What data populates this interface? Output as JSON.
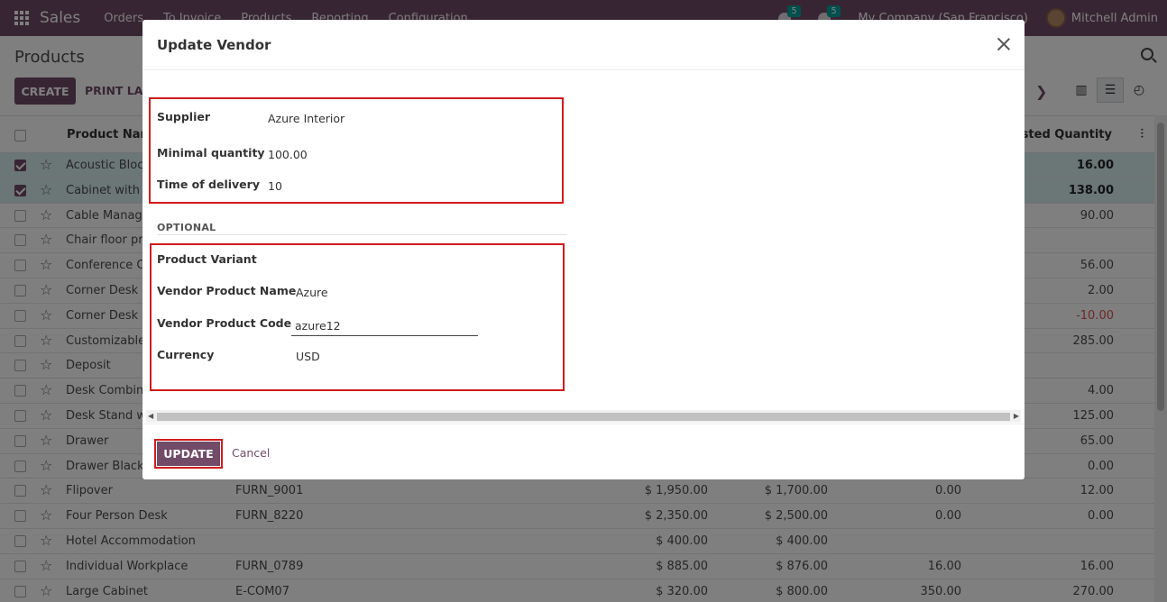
{
  "navbar": {
    "brand": "Sales",
    "menu": [
      "Orders",
      "To Invoice",
      "Products",
      "Reporting",
      "Configuration"
    ],
    "messages_count": "5",
    "activities_count": "5",
    "company": "My Company (San Francisco)",
    "user": "Mitchell Admin"
  },
  "control_panel": {
    "breadcrumb": "Products",
    "create_label": "CREATE",
    "print_label": "PRINT LABELS"
  },
  "list": {
    "columns": {
      "name": "Product Name",
      "forecast": "Forecasted Quantity"
    },
    "rows": [
      {
        "name": "Acoustic Bloc Screens",
        "ref": "",
        "price": "",
        "cost": "",
        "onhand": "",
        "forecast": "16.00",
        "selected": true
      },
      {
        "name": "Cabinet with Doors",
        "ref": "",
        "price": "",
        "cost": "",
        "onhand": "",
        "forecast": "138.00",
        "selected": true
      },
      {
        "name": "Cable Management Box",
        "ref": "",
        "price": "",
        "cost": "",
        "onhand": "",
        "forecast": "90.00",
        "selected": false
      },
      {
        "name": "Chair floor protection",
        "ref": "",
        "price": "",
        "cost": "",
        "onhand": "",
        "forecast": "",
        "selected": false
      },
      {
        "name": "Conference Chair",
        "ref": "",
        "price": "",
        "cost": "",
        "onhand": "",
        "forecast": "56.00",
        "selected": false
      },
      {
        "name": "Corner Desk Left Sit",
        "ref": "",
        "price": "",
        "cost": "",
        "onhand": "",
        "forecast": "2.00",
        "selected": false
      },
      {
        "name": "Corner Desk Right Sit",
        "ref": "",
        "price": "",
        "cost": "",
        "onhand": "",
        "forecast": "-10.00",
        "selected": false,
        "negative": true
      },
      {
        "name": "Customizable Desk",
        "ref": "",
        "price": "",
        "cost": "",
        "onhand": "",
        "forecast": "285.00",
        "selected": false
      },
      {
        "name": "Deposit",
        "ref": "",
        "price": "",
        "cost": "",
        "onhand": "",
        "forecast": "",
        "selected": false
      },
      {
        "name": "Desk Combination",
        "ref": "",
        "price": "",
        "cost": "",
        "onhand": "",
        "forecast": "4.00",
        "selected": false
      },
      {
        "name": "Desk Stand with Screen",
        "ref": "",
        "price": "",
        "cost": "",
        "onhand": "",
        "forecast": "125.00",
        "selected": false
      },
      {
        "name": "Drawer",
        "ref": "",
        "price": "",
        "cost": "",
        "onhand": "",
        "forecast": "65.00",
        "selected": false
      },
      {
        "name": "Drawer Black",
        "ref": "",
        "price": "",
        "cost": "",
        "onhand": "",
        "forecast": "0.00",
        "selected": false
      },
      {
        "name": "Flipover",
        "ref": "FURN_9001",
        "price": "$ 1,950.00",
        "cost": "$ 1,700.00",
        "onhand": "0.00",
        "forecast": "12.00",
        "selected": false
      },
      {
        "name": "Four Person Desk",
        "ref": "FURN_8220",
        "price": "$ 2,350.00",
        "cost": "$ 2,500.00",
        "onhand": "0.00",
        "forecast": "0.00",
        "selected": false
      },
      {
        "name": "Hotel Accommodation",
        "ref": "",
        "price": "$ 400.00",
        "cost": "$ 400.00",
        "onhand": "",
        "forecast": "",
        "selected": false
      },
      {
        "name": "Individual Workplace",
        "ref": "FURN_0789",
        "price": "$ 885.00",
        "cost": "$ 876.00",
        "onhand": "16.00",
        "forecast": "16.00",
        "selected": false
      },
      {
        "name": "Large Cabinet",
        "ref": "E-COM07",
        "price": "$ 320.00",
        "cost": "$ 800.00",
        "onhand": "350.00",
        "forecast": "270.00",
        "selected": false
      }
    ]
  },
  "modal": {
    "title": "Update Vendor",
    "supplier_label": "Supplier",
    "supplier_value": "Azure Interior",
    "min_qty_label": "Minimal quantity",
    "min_qty_value": "100.00",
    "delivery_label": "Time of delivery",
    "delivery_value": "10",
    "optional_title": "OPTIONAL",
    "variant_label": "Product Variant",
    "vendor_name_label": "Vendor Product Name",
    "vendor_name_value": "Azure",
    "vendor_code_label": "Vendor Product Code",
    "vendor_code_value": "azure12",
    "currency_label": "Currency",
    "currency_value": "USD",
    "update_label": "UPDATE",
    "cancel_label": "Cancel"
  },
  "colors": {
    "brand": "#714b67",
    "highlight": "#d01c1c",
    "selected_row": "#d7eded",
    "negative": "#d9534f"
  },
  "icons": [
    "apps-grid-icon",
    "chat-icon",
    "clock-icon",
    "search-icon",
    "kanban-view-icon",
    "list-view-icon",
    "activity-view-icon",
    "star-icon",
    "close-icon",
    "column-settings-icon"
  ]
}
